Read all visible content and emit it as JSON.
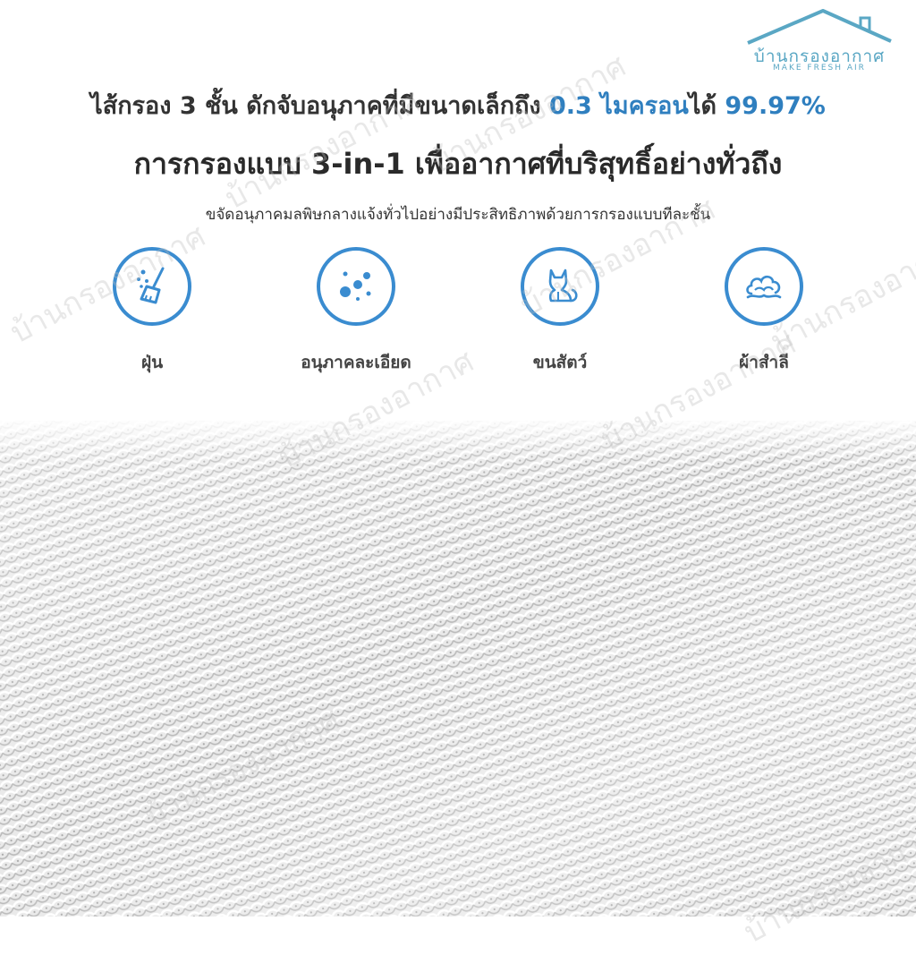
{
  "brand": {
    "name": "บ้านกรองอากาศ",
    "tagline": "MAKE FRESH AIR",
    "color": "#5aa7c4"
  },
  "headline": {
    "part1": "ไส้กรอง 3 ชั้น ดักจับอนุภาคที่มีขนาดเล็กถึง ",
    "highlight1": "0.3 ไมครอน",
    "part2": "ได้ ",
    "highlight2": "99.97%",
    "highlight_color": "#2f7fbf"
  },
  "headline2": "การกรองแบบ 3-in-1 เพื่ออากาศที่บริสุทธิ์อย่างทั่วถึง",
  "subtitle": "ขจัดอนุภาคมลพิษกลางแจ้งทั่วไปอย่างมีประสิทธิภาพด้วยการกรองแบบทีละชั้น",
  "features": [
    {
      "label": "ฝุ่น",
      "icon": "dust-broom-icon"
    },
    {
      "label": "อนุภาคละเอียด",
      "icon": "fine-particles-icon"
    },
    {
      "label": "ขนสัตว์",
      "icon": "pet-cat-icon"
    },
    {
      "label": "ผ้าสำลี",
      "icon": "cotton-lint-icon"
    }
  ],
  "accent_color": "#3a8cd0",
  "watermark_text": "บ้านกรองอากาศ"
}
